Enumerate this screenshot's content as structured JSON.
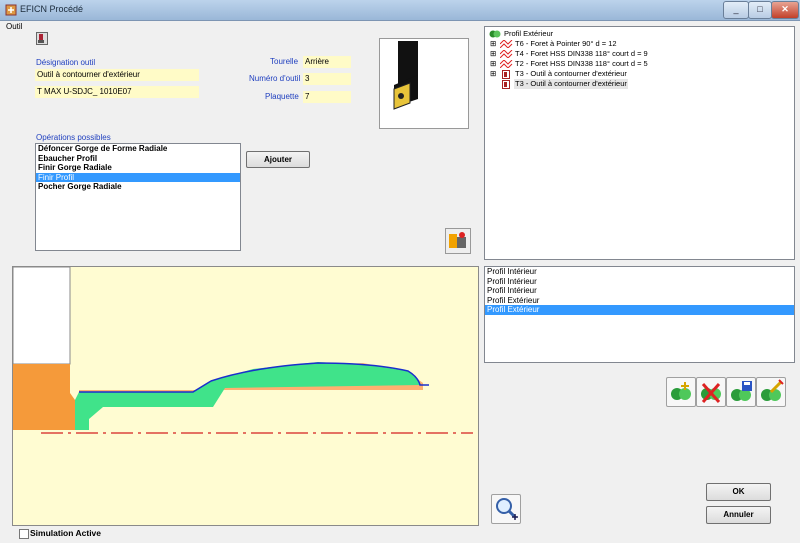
{
  "window": {
    "title": "EFICN Procédé"
  },
  "outil_section": {
    "label": "Outil"
  },
  "designation": {
    "label": "Désignation outil",
    "value1": "Outil à contourner d'extérieur",
    "value2": "T MAX U-SDJC_ 1010E07"
  },
  "tool_props": {
    "tourelle_label": "Tourelle",
    "tourelle_value": "Arrière",
    "numero_label": "Numéro d'outil",
    "numero_value": "3",
    "plaquette_label": "Plaquette",
    "plaquette_value": "7"
  },
  "operations": {
    "label": "Opérations possibles",
    "items": [
      "Défoncer Gorge de Forme Radiale",
      "Ebaucher Profil",
      "Finir Gorge Radiale",
      "Finir Profil",
      "Pocher Gorge Radiale"
    ],
    "selected_index": 3,
    "add_button": "Ajouter"
  },
  "tree": {
    "root": "Profil Extérieur",
    "items": [
      "T6 - Foret à Pointer 90° d = 12",
      "T4 - Foret HSS DIN338 118° court d = 9",
      "T2 - Foret HSS DIN338 118° court d = 5",
      "T3 - Outil à contourner d'extérieur",
      "T3 - Outil à contourner d'extérieur"
    ]
  },
  "profiles": {
    "items": [
      "Profil Intérieur",
      "Profil Intérieur",
      "Profil Intérieur",
      "Profil Extérieur",
      "Profil Extérieur"
    ],
    "selected_index": 4
  },
  "buttons": {
    "ok": "OK",
    "cancel": "Annuler"
  },
  "simulation": {
    "label": "Simulation Active",
    "checked": false
  },
  "icons": {
    "app": "app-icon",
    "tool_small": "tool-icon",
    "tool_library": "tool-library-icon",
    "zoom": "zoom-in-icon",
    "add_op": "add-operation-icon",
    "delete_op": "delete-operation-icon",
    "save_op": "save-operation-icon",
    "edit_op": "edit-operation-icon"
  },
  "colors": {
    "field_bg": "#fffbc7",
    "label_blue": "#1f3fbf",
    "selection": "#3399ff",
    "part_green": "#40e38a",
    "chuck_orange": "#f59a3a",
    "axis_red": "#d42020",
    "canvas_bg": "#fffcd2"
  }
}
